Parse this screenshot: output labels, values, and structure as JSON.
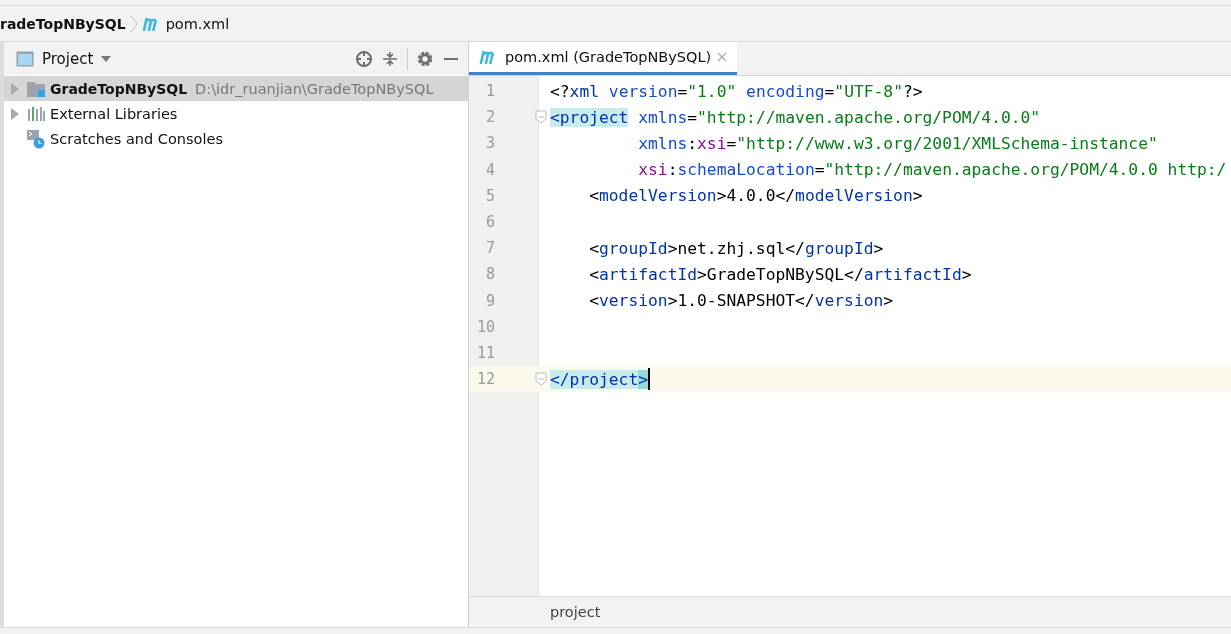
{
  "breadcrumb": [
    {
      "label": "radeTopNBySQL",
      "kind": "project"
    },
    {
      "label": "pom.xml",
      "kind": "maven"
    }
  ],
  "project_panel": {
    "title": "Project",
    "tree": [
      {
        "label": "GradeTopNBySQL",
        "path": "D:\\idr_ruanjian\\GradeTopNBySQL",
        "kind": "module",
        "selected": true,
        "expanded": false
      },
      {
        "label": "External Libraries",
        "kind": "libraries",
        "selected": false,
        "expanded": false
      },
      {
        "label": "Scratches and Consoles",
        "kind": "scratches",
        "selected": false
      }
    ]
  },
  "editor": {
    "tabs": [
      {
        "label": "pom.xml (GradeTopNBySQL)",
        "selected": true
      }
    ],
    "lines": [
      {
        "number": "1",
        "tokens": [
          {
            "t": "<?",
            "kind": "punct"
          },
          {
            "t": "xml",
            "kind": "tag"
          },
          {
            "t": " version",
            "kind": "attr"
          },
          {
            "t": "=",
            "kind": "punct"
          },
          {
            "t": "\"1.0\"",
            "kind": "string"
          },
          {
            "t": " encoding",
            "kind": "attr"
          },
          {
            "t": "=",
            "kind": "punct"
          },
          {
            "t": "\"UTF-8\"",
            "kind": "string"
          },
          {
            "t": "?>",
            "kind": "punct"
          }
        ]
      },
      {
        "number": "2",
        "fold": true,
        "tokens": [
          {
            "t": "<project",
            "kind": "match"
          },
          {
            "t": " xmlns",
            "kind": "attr"
          },
          {
            "t": "=",
            "kind": "punct"
          },
          {
            "t": "\"http://maven.apache.org/POM/4.0.0\"",
            "kind": "string"
          }
        ]
      },
      {
        "number": "3",
        "tokens": [
          {
            "t": "         xmlns",
            "kind": "attr"
          },
          {
            "t": ":",
            "kind": "punct"
          },
          {
            "t": "xsi",
            "kind": "namespace"
          },
          {
            "t": "=",
            "kind": "punct"
          },
          {
            "t": "\"http://www.w3.org/2001/XMLSchema-instance\"",
            "kind": "string"
          }
        ]
      },
      {
        "number": "4",
        "tokens": [
          {
            "t": "         xsi",
            "kind": "namespace"
          },
          {
            "t": ":",
            "kind": "punct"
          },
          {
            "t": "schemaLocation",
            "kind": "attr"
          },
          {
            "t": "=",
            "kind": "punct"
          },
          {
            "t": "\"http://maven.apache.org/POM/4.0.0 http:/",
            "kind": "string"
          }
        ]
      },
      {
        "number": "5",
        "tokens": [
          {
            "t": "    <",
            "kind": "punct"
          },
          {
            "t": "modelVersion",
            "kind": "tag"
          },
          {
            "t": ">4.0.0</",
            "kind": "punct"
          },
          {
            "t": "modelVersion",
            "kind": "tag"
          },
          {
            "t": ">",
            "kind": "punct"
          }
        ]
      },
      {
        "number": "6"
      },
      {
        "number": "7",
        "tokens": [
          {
            "t": "    <",
            "kind": "punct"
          },
          {
            "t": "groupId",
            "kind": "tag"
          },
          {
            "t": ">net.zhj.sql</",
            "kind": "punct"
          },
          {
            "t": "groupId",
            "kind": "tag"
          },
          {
            "t": ">",
            "kind": "punct"
          }
        ]
      },
      {
        "number": "8",
        "tokens": [
          {
            "t": "    <",
            "kind": "punct"
          },
          {
            "t": "artifactId",
            "kind": "tag"
          },
          {
            "t": ">GradeTopNBySQL</",
            "kind": "punct"
          },
          {
            "t": "artifactId",
            "kind": "tag"
          },
          {
            "t": ">",
            "kind": "punct"
          }
        ]
      },
      {
        "number": "9",
        "tokens": [
          {
            "t": "    <",
            "kind": "punct"
          },
          {
            "t": "version",
            "kind": "tag"
          },
          {
            "t": ">1.0-SNAPSHOT</",
            "kind": "punct"
          },
          {
            "t": "version",
            "kind": "tag"
          },
          {
            "t": ">",
            "kind": "punct"
          }
        ]
      },
      {
        "number": "10"
      },
      {
        "number": "11"
      },
      {
        "number": "12",
        "fold": true,
        "current": true,
        "tokens": [
          {
            "t": "</project",
            "kind": "match"
          },
          {
            "t": ">",
            "kind": "match-end"
          }
        ]
      }
    ],
    "status_breadcrumb": "project"
  }
}
